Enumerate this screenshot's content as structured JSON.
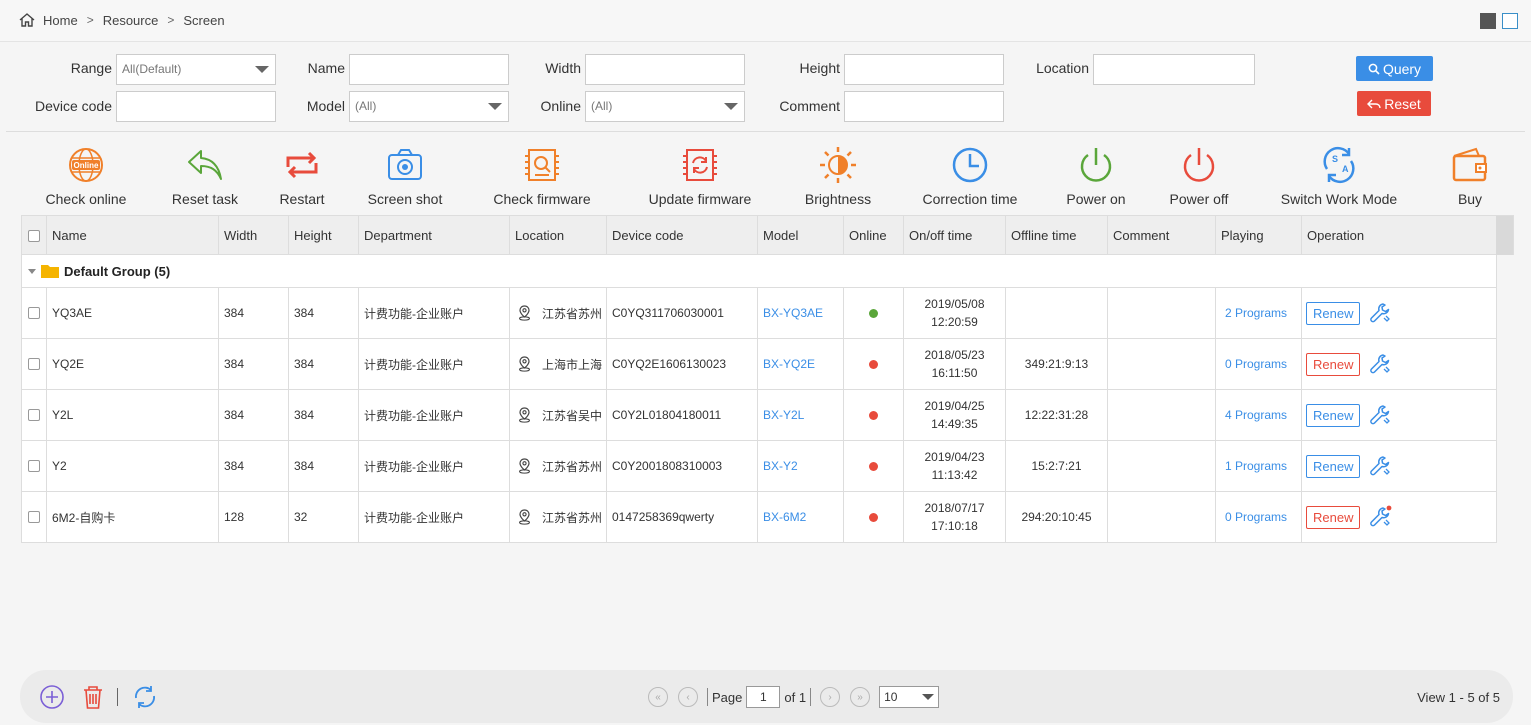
{
  "breadcrumb": {
    "home": "Home",
    "resource": "Resource",
    "screen": "Screen",
    "sep": ">"
  },
  "filters": {
    "range_label": "Range",
    "range_value": "All(Default)",
    "name_label": "Name",
    "name_value": "",
    "width_label": "Width",
    "width_value": "",
    "height_label": "Height",
    "height_value": "",
    "location_label": "Location",
    "location_value": "",
    "device_code_label": "Device code",
    "device_code_value": "",
    "model_label": "Model",
    "model_value": "(All)",
    "online_label": "Online",
    "online_value": "(All)",
    "comment_label": "Comment",
    "comment_value": "",
    "query_label": "Query",
    "reset_label": "Reset"
  },
  "toolbar": [
    {
      "label": "Check online",
      "icon": "check-online-icon"
    },
    {
      "label": "Reset task",
      "icon": "reset-task-icon"
    },
    {
      "label": "Restart",
      "icon": "restart-icon"
    },
    {
      "label": "Screen shot",
      "icon": "camera-icon"
    },
    {
      "label": "Check firmware",
      "icon": "check-firmware-icon"
    },
    {
      "label": "Update firmware",
      "icon": "update-firmware-icon"
    },
    {
      "label": "Brightness",
      "icon": "brightness-icon"
    },
    {
      "label": "Correction time",
      "icon": "clock-icon"
    },
    {
      "label": "Power on",
      "icon": "power-on-icon"
    },
    {
      "label": "Power off",
      "icon": "power-off-icon"
    },
    {
      "label": "Switch Work Mode",
      "icon": "switch-mode-icon"
    },
    {
      "label": "Buy",
      "icon": "wallet-icon"
    }
  ],
  "table": {
    "columns": [
      "Name",
      "Width",
      "Height",
      "Department",
      "Location",
      "Device code",
      "Model",
      "Online",
      "On/off time",
      "Offline time",
      "Comment",
      "Playing",
      "Operation"
    ],
    "group": "Default Group (5)",
    "renew_label": "Renew",
    "rows": [
      {
        "name": "YQ3AE",
        "width": "384",
        "height": "384",
        "department": "计费功能-企业账户",
        "location": "江苏省苏州",
        "device_code": "C0YQ311706030001",
        "model": "BX-YQ3AE",
        "online": true,
        "onoff_date": "2019/05/08",
        "onoff_time": "12:20:59",
        "offline_time": "",
        "comment": "",
        "playing": "2 Programs",
        "renew_state": "normal"
      },
      {
        "name": "YQ2E",
        "width": "384",
        "height": "384",
        "department": "计费功能-企业账户",
        "location": "上海市上海",
        "device_code": "C0YQ2E1606130023",
        "model": "BX-YQ2E",
        "online": false,
        "onoff_date": "2018/05/23",
        "onoff_time": "16:11:50",
        "offline_time": "349:21:9:13",
        "comment": "",
        "playing": "0 Programs",
        "renew_state": "warning"
      },
      {
        "name": "Y2L",
        "width": "384",
        "height": "384",
        "department": "计费功能-企业账户",
        "location": "江苏省吴中",
        "device_code": "C0Y2L01804180011",
        "model": "BX-Y2L",
        "online": false,
        "onoff_date": "2019/04/25",
        "onoff_time": "14:49:35",
        "offline_time": "12:22:31:28",
        "comment": "",
        "playing": "4 Programs",
        "renew_state": "normal"
      },
      {
        "name": "Y2",
        "width": "384",
        "height": "384",
        "department": "计费功能-企业账户",
        "location": "江苏省苏州",
        "device_code": "C0Y2001808310003",
        "model": "BX-Y2",
        "online": false,
        "onoff_date": "2019/04/23",
        "onoff_time": "11:13:42",
        "offline_time": "15:2:7:21",
        "comment": "",
        "playing": "1 Programs",
        "renew_state": "normal"
      },
      {
        "name": "6M2-自购卡",
        "width": "128",
        "height": "32",
        "department": "计费功能-企业账户",
        "location": "江苏省苏州",
        "device_code": "0147258369qwerty",
        "model": "BX-6M2",
        "online": false,
        "onoff_date": "2018/07/17",
        "onoff_time": "17:10:18",
        "offline_time": "294:20:10:45",
        "comment": "",
        "playing": "0 Programs",
        "renew_state": "warning"
      }
    ]
  },
  "pager": {
    "page_label": "Page",
    "page_value": "1",
    "of_label": "of 1",
    "page_size": "10",
    "view_info": "View 1 - 5 of 5"
  },
  "colors": {
    "accent": "#3a8ee6",
    "danger": "#e84b3c",
    "online": "#5aa63a",
    "offline": "#e84b3c"
  }
}
